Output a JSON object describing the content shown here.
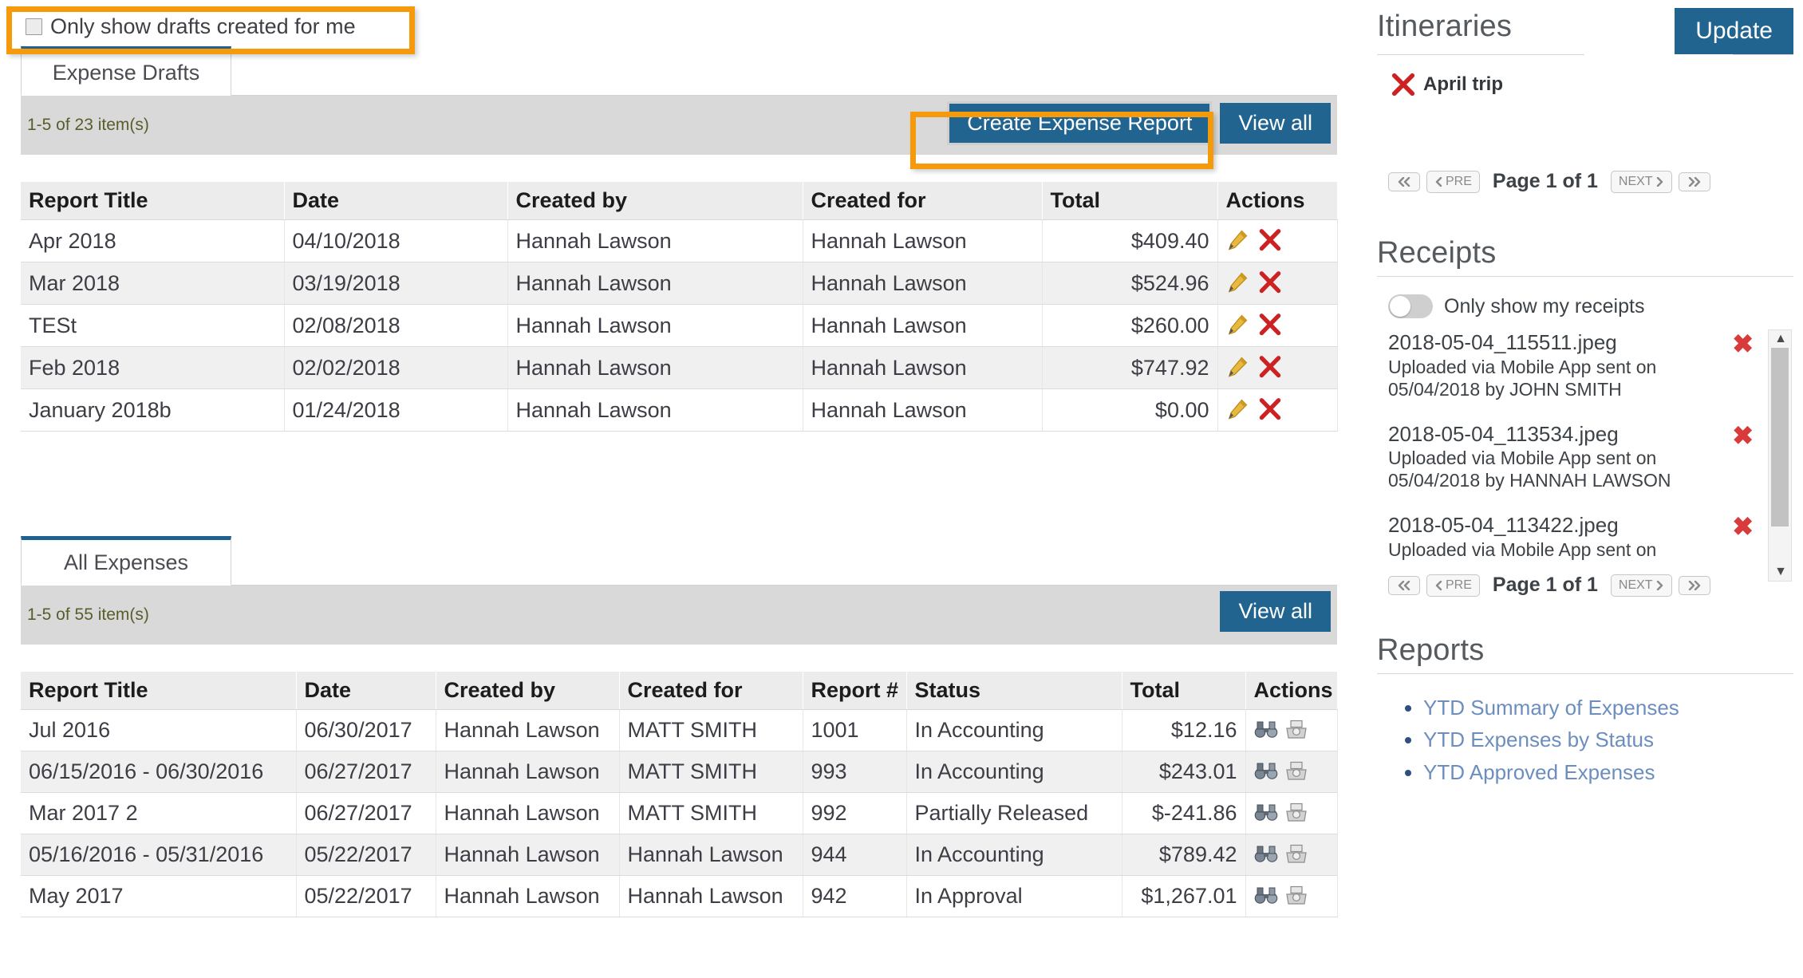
{
  "filter": {
    "only_drafts_label": "Only show drafts created for me",
    "checked": false
  },
  "drafts_panel": {
    "tab_label": "Expense Drafts",
    "count_text": "1-5 of 23 item(s)",
    "create_button": "Create Expense Report",
    "view_all_button": "View all",
    "columns": [
      "Report Title",
      "Date",
      "Created by",
      "Created for",
      "Total",
      "Actions"
    ],
    "rows": [
      {
        "title": "Apr 2018",
        "date": "04/10/2018",
        "created_by": "Hannah Lawson",
        "created_for": "Hannah Lawson",
        "total": "$409.40"
      },
      {
        "title": "Mar 2018",
        "date": "03/19/2018",
        "created_by": "Hannah Lawson",
        "created_for": "Hannah Lawson",
        "total": "$524.96"
      },
      {
        "title": "TESt",
        "date": "02/08/2018",
        "created_by": "Hannah Lawson",
        "created_for": "Hannah Lawson",
        "total": "$260.00"
      },
      {
        "title": "Feb 2018",
        "date": "02/02/2018",
        "created_by": "Hannah Lawson",
        "created_for": "Hannah Lawson",
        "total": "$747.92"
      },
      {
        "title": "January 2018b",
        "date": "01/24/2018",
        "created_by": "Hannah Lawson",
        "created_for": "Hannah Lawson",
        "total": "$0.00"
      }
    ]
  },
  "expenses_panel": {
    "tab_label": "All Expenses",
    "count_text": "1-5 of 55 item(s)",
    "view_all_button": "View all",
    "columns": [
      "Report Title",
      "Date",
      "Created by",
      "Created for",
      "Report #",
      "Status",
      "Total",
      "Actions"
    ],
    "rows": [
      {
        "title": "Jul 2016",
        "date": "06/30/2017",
        "created_by": "Hannah Lawson",
        "created_for": "MATT SMITH",
        "report_no": "1001",
        "status": "In Accounting",
        "total": "$12.16"
      },
      {
        "title": "06/15/2016 - 06/30/2016",
        "date": "06/27/2017",
        "created_by": "Hannah Lawson",
        "created_for": "MATT SMITH",
        "report_no": "993",
        "status": "In Accounting",
        "total": "$243.01"
      },
      {
        "title": "Mar 2017 2",
        "date": "06/27/2017",
        "created_by": "Hannah Lawson",
        "created_for": "MATT SMITH",
        "report_no": "992",
        "status": "Partially Released",
        "total": "$-241.86"
      },
      {
        "title": "05/16/2016 - 05/31/2016",
        "date": "05/22/2017",
        "created_by": "Hannah Lawson",
        "created_for": "Hannah Lawson",
        "report_no": "944",
        "status": "In Accounting",
        "total": "$789.42"
      },
      {
        "title": "May 2017",
        "date": "05/22/2017",
        "created_by": "Hannah Lawson",
        "created_for": "Hannah Lawson",
        "report_no": "942",
        "status": "In Approval",
        "total": "$1,267.01"
      }
    ]
  },
  "itineraries": {
    "title": "Itineraries",
    "update_button": "Update",
    "items": [
      {
        "name": "April trip"
      }
    ],
    "pager": {
      "first": "«",
      "prev": "PRE",
      "page_label": "Page 1 of 1",
      "next": "NEXT",
      "last": "»"
    }
  },
  "receipts": {
    "title": "Receipts",
    "toggle_label": "Only show my receipts",
    "toggle_on": false,
    "items": [
      {
        "name": "2018-05-04_115511.jpeg",
        "desc": "Uploaded via Mobile App sent on 05/04/2018 by JOHN SMITH"
      },
      {
        "name": "2018-05-04_113534.jpeg",
        "desc": "Uploaded via Mobile App sent on 05/04/2018 by HANNAH LAWSON"
      },
      {
        "name": "2018-05-04_113422.jpeg",
        "desc": "Uploaded via Mobile App sent on"
      }
    ],
    "pager": {
      "first": "«",
      "prev": "PRE",
      "page_label": "Page 1 of 1",
      "next": "NEXT",
      "last": "»"
    }
  },
  "reports": {
    "title": "Reports",
    "links": [
      "YTD Summary of Expenses",
      "YTD Expenses by Status",
      "YTD Approved Expenses"
    ]
  },
  "colors": {
    "accent_blue": "#21648f",
    "highlight_orange": "#f59a0b",
    "link_blue": "#6c8ebf",
    "delete_red": "#d93b3b",
    "toolbar_grey": "#d9d9d9"
  }
}
